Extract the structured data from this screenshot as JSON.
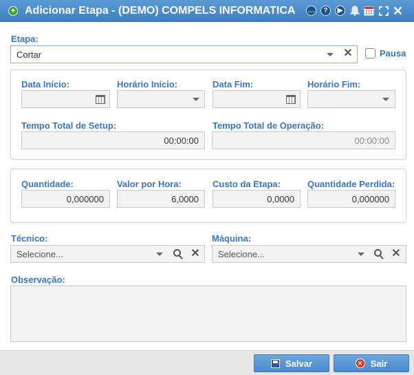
{
  "window": {
    "title": "Adicionar Etapa - (DEMO) COMPELS INFORMATICA",
    "icons": [
      "app-add-icon",
      "chat-icon",
      "help-icon",
      "play-icon",
      "bell-icon",
      "calendar-icon",
      "fullscreen-icon",
      "close-icon"
    ],
    "help_glyph": "?"
  },
  "etapa": {
    "label": "Etapa:",
    "value": "Cortar"
  },
  "pausa": {
    "label": "Pausa",
    "checked": false
  },
  "schedule": {
    "data_inicio": {
      "label": "Data Início:",
      "value": ""
    },
    "horario_inicio": {
      "label": "Horário Início:",
      "value": ""
    },
    "data_fim": {
      "label": "Data Fim:",
      "value": ""
    },
    "horario_fim": {
      "label": "Horário Fim:",
      "value": ""
    },
    "tempo_setup": {
      "label": "Tempo Total de Setup:",
      "value": "00:00:00"
    },
    "tempo_operacao": {
      "label": "Tempo Total de Operação:",
      "value": "00:00:00"
    }
  },
  "costs": {
    "quantidade": {
      "label": "Quantidade:",
      "value": "0,000000"
    },
    "valor_hora": {
      "label": "Valor por Hora:",
      "value": "6,0000"
    },
    "custo_etapa": {
      "label": "Custo da Etapa:",
      "value": "0,0000"
    },
    "quantidade_perdida": {
      "label": "Quantidade Perdida:",
      "value": "0,000000"
    }
  },
  "tecnico": {
    "label": "Técnico:",
    "placeholder": "Selecione..."
  },
  "maquina": {
    "label": "Máquina:",
    "placeholder": "Selecione..."
  },
  "observacao": {
    "label": "Observação:",
    "value": ""
  },
  "buttons": {
    "save": "Salvar",
    "exit": "Sair"
  },
  "colors": {
    "titlebar": "#4a8ccf",
    "label": "#3a76c0",
    "button": "#5a98d8"
  }
}
